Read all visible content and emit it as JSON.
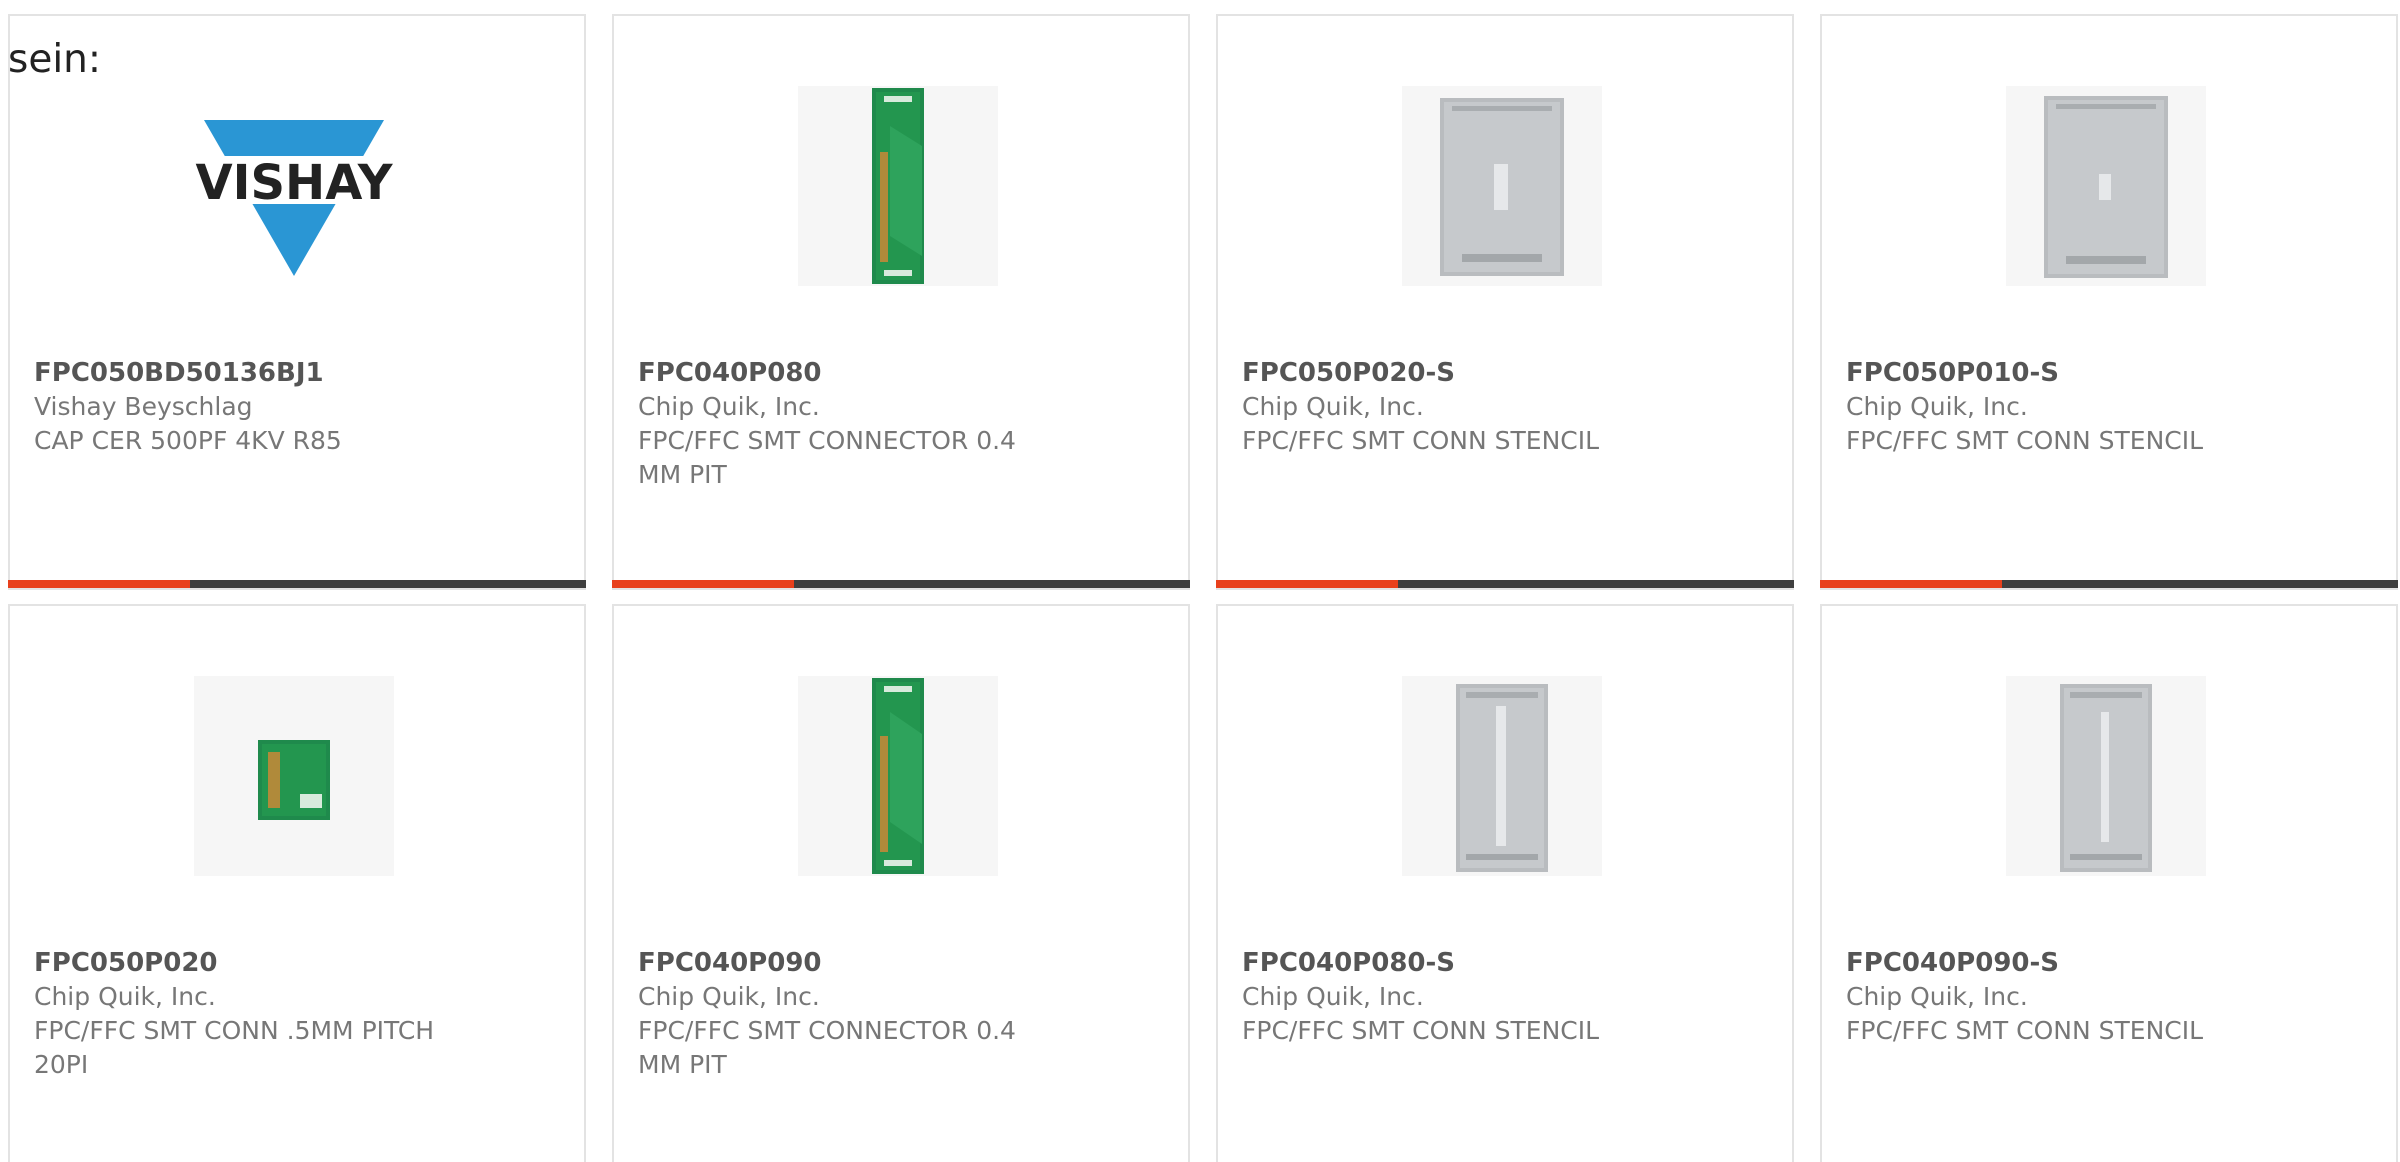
{
  "intro_text": "sein:",
  "colors": {
    "accent": "#e8401c",
    "bar_dark": "#3f3f3f",
    "pcb_green": "#1f8a4c",
    "stencil_gray": "#b9bcbf",
    "vishay_blue": "#2a96d4"
  },
  "cards": [
    {
      "part_number": "FPC050BD50136BJ1",
      "manufacturer": "Vishay Beyschlag",
      "description": "CAP CER 500PF 4KV R85",
      "image_icon": "vishay-logo",
      "logo_text": "VISHAY"
    },
    {
      "part_number": "FPC040P080",
      "manufacturer": "Chip Quik, Inc.",
      "description": "FPC/FFC SMT CONNECTOR 0.4\nMM PIT",
      "image_icon": "pcb-adapter-long"
    },
    {
      "part_number": "FPC050P020-S",
      "manufacturer": "Chip Quik, Inc.",
      "description": "FPC/FFC SMT CONN STENCIL",
      "image_icon": "stencil"
    },
    {
      "part_number": "FPC050P010-S",
      "manufacturer": "Chip Quik, Inc.",
      "description": "FPC/FFC SMT CONN STENCIL",
      "image_icon": "stencil"
    },
    {
      "part_number": "FPC050P020",
      "manufacturer": "Chip Quik, Inc.",
      "description": "FPC/FFC SMT CONN .5MM PITCH\n20PI",
      "image_icon": "pcb-adapter-small"
    },
    {
      "part_number": "FPC040P090",
      "manufacturer": "Chip Quik, Inc.",
      "description": "FPC/FFC SMT CONNECTOR 0.4\nMM PIT",
      "image_icon": "pcb-adapter-long"
    },
    {
      "part_number": "FPC040P080-S",
      "manufacturer": "Chip Quik, Inc.",
      "description": "FPC/FFC SMT CONN STENCIL",
      "image_icon": "stencil-long"
    },
    {
      "part_number": "FPC040P090-S",
      "manufacturer": "Chip Quik, Inc.",
      "description": "FPC/FFC SMT CONN STENCIL",
      "image_icon": "stencil-long"
    }
  ]
}
